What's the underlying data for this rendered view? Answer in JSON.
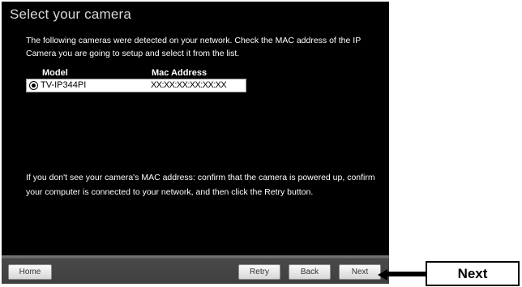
{
  "window": {
    "title": "Select your camera",
    "intro": "The following cameras were detected on your network. Check the MAC address of the IP Camera you are going to setup and select it from the list."
  },
  "camera_table": {
    "columns": [
      "Model",
      "Mac Address"
    ],
    "rows": [
      {
        "model": "TV-IP344PI",
        "mac": "XX:XX:XX:XX:XX:XX",
        "selected": true
      }
    ]
  },
  "help_text": "If you don't see your camera's MAC address: confirm that the camera is powered up, confirm your computer is connected to your network, and then click the Retry button.",
  "buttons": {
    "home": "Home",
    "retry": "Retry",
    "back": "Back",
    "next": "Next"
  },
  "callout": {
    "label": "Next"
  }
}
